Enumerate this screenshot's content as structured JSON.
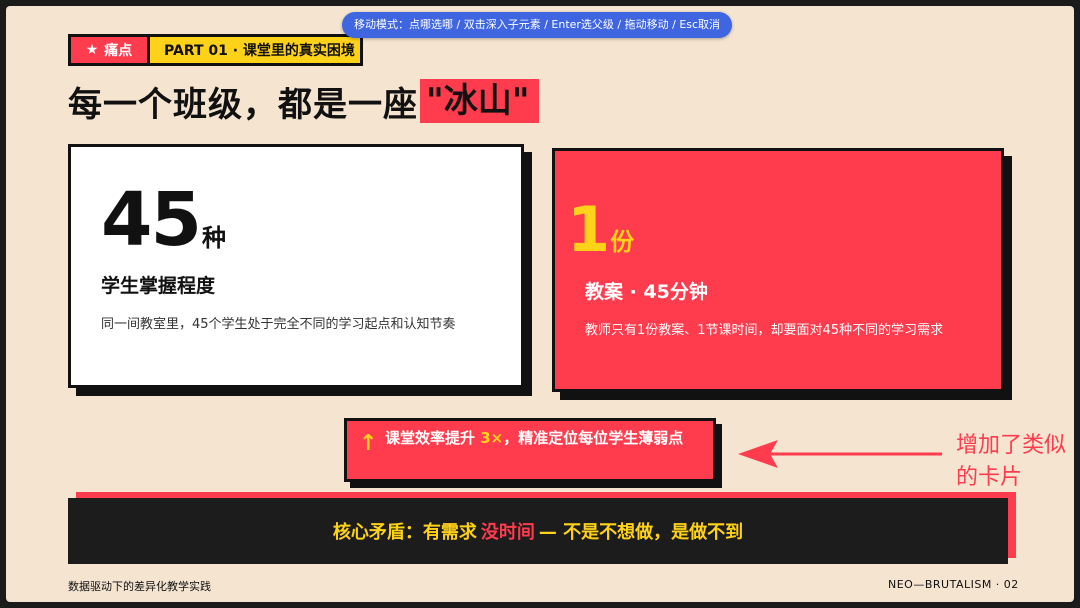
{
  "hint_bar": "移动模式：点哪选哪 / 双击深入子元素 / Enter选父级 / 拖动移动 / Esc取消",
  "tags": {
    "pain_icon": "★",
    "pain_label": "痛点",
    "part_label": "PART 01 · 课堂里的真实困境"
  },
  "headline": {
    "main": "每一个班级，都是一座",
    "highlight": "\"冰山\""
  },
  "cards": [
    {
      "number": "45",
      "unit": "种",
      "title": "学生掌握程度",
      "description": "同一间教室里，45个学生处于完全不同的学习起点和认知节奏"
    },
    {
      "number": "1",
      "unit": "份",
      "title": "教案 · 45分钟",
      "description": "教师只有1份教案、1节课时间，却要面对45种不同的学习需求"
    }
  ],
  "callout": {
    "arrow_icon": "↑",
    "text_before": "课堂效率提升 ",
    "highlight": "3×",
    "text_after": "，精准定位每位学生薄弱点"
  },
  "annotation": "增加了类似的卡片",
  "banner": {
    "part1": "核心矛盾：有需求",
    "part2": "没时间",
    "part3": "— 不是不想做，是做不到"
  },
  "footer": {
    "left": "数据驱动下的差异化教学实践",
    "right": "NEO—BRUTALISM · 02"
  },
  "colors": {
    "red": "#ff3b4e",
    "yellow": "#ffd21a",
    "black": "#111111",
    "background": "#f4e4d0",
    "hint_blue": "#3f66e0"
  }
}
